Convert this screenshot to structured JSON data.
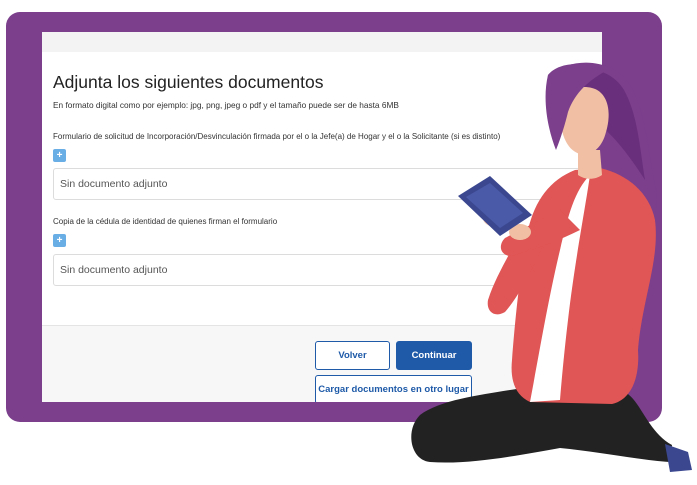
{
  "form": {
    "title": "Adjunta los siguientes documentos",
    "subtitle": "En formato digital como por ejemplo: jpg, png, jpeg o pdf y el tamaño puede ser de hasta 6MB",
    "documents": [
      {
        "label": "Formulario de solicitud de Incorporación/Desvinculación firmada por el o la Jefe(a) de Hogar y el o la Solicitante (si es distinto)",
        "add_icon": "plus-icon",
        "status": "Sin documento adjunto"
      },
      {
        "label": "Copia de la cédula de identidad de quienes firman el formulario",
        "add_icon": "plus-icon",
        "status": "Sin documento adjunto"
      }
    ],
    "buttons": {
      "back": "Volver",
      "continue": "Continuar",
      "more": "Cargar documentos en otro lugar"
    }
  },
  "colors": {
    "frame": "#7b3f8c",
    "primary": "#1e5aa8",
    "add_button": "#6aaee6"
  }
}
